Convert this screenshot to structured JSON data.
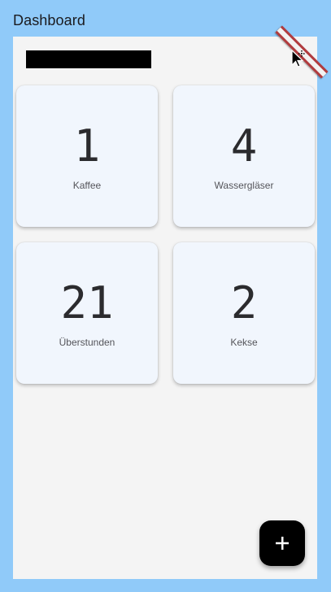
{
  "app_bar": {
    "title": "Dashboard"
  },
  "header": {
    "redacted_label": ""
  },
  "cards": [
    {
      "value": "1",
      "label": "Kaffee"
    },
    {
      "value": "4",
      "label": "Wassergläser"
    },
    {
      "value": "21",
      "label": "Überstunden"
    },
    {
      "value": "2",
      "label": "Kekse"
    }
  ],
  "fab": {
    "icon": "plus-icon"
  },
  "colors": {
    "background": "#90caf9",
    "surface": "#f4f4f4",
    "card": "#f1f6fd",
    "fab": "#000000",
    "debug_banner": "#b13b3e"
  }
}
